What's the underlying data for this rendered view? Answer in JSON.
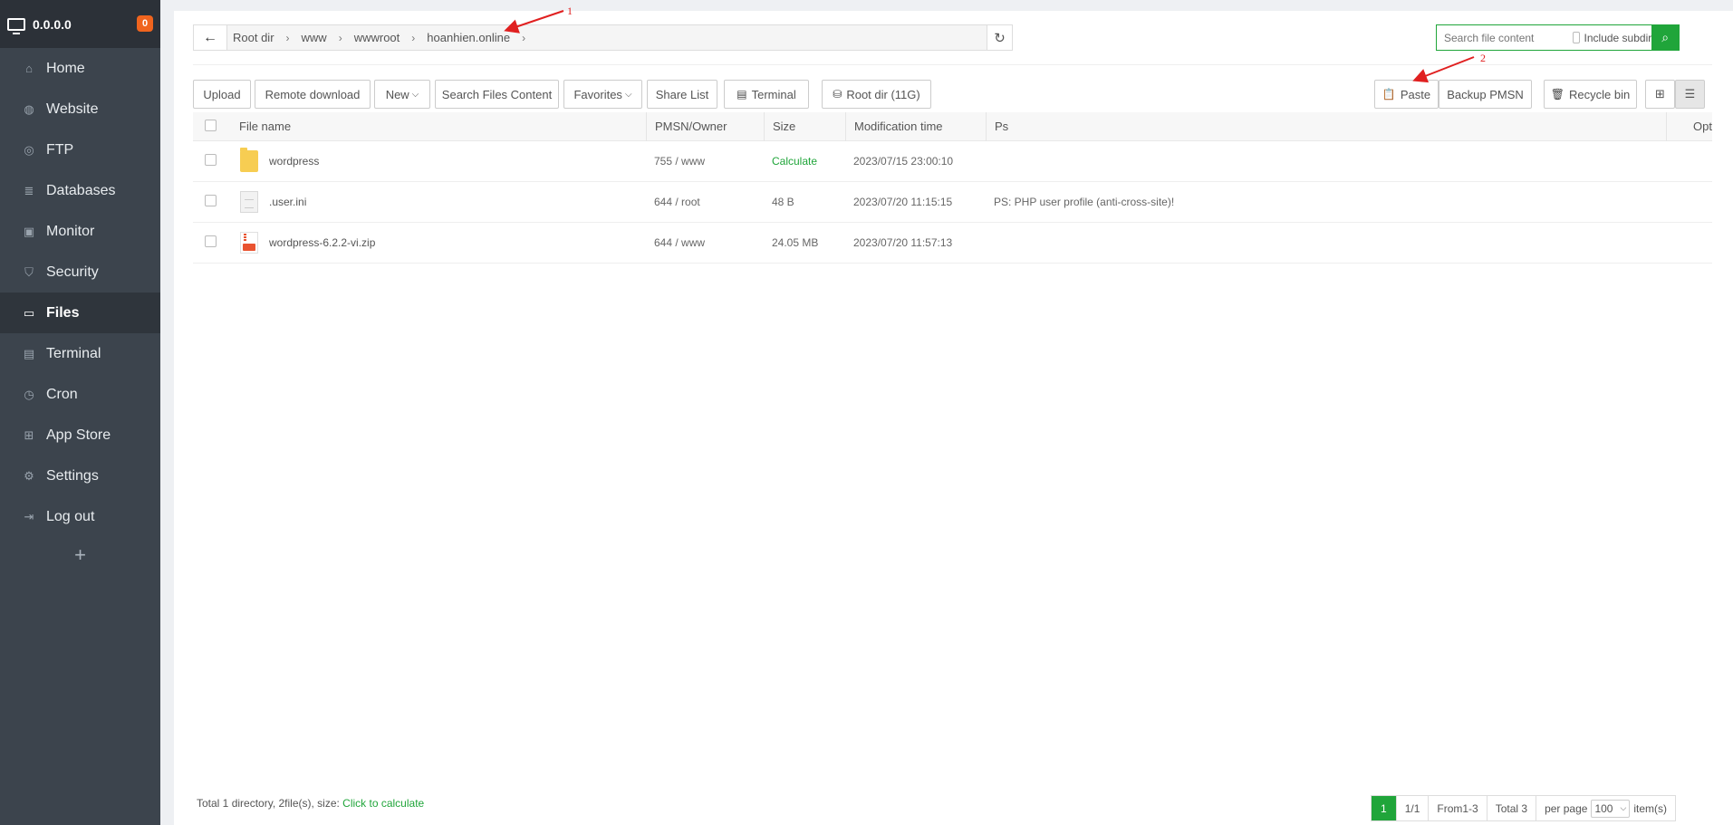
{
  "sidebar": {
    "title": "0.0.0.0",
    "badge": "0",
    "items": [
      {
        "label": "Home",
        "icon": "home-icon"
      },
      {
        "label": "Website",
        "icon": "globe-icon"
      },
      {
        "label": "FTP",
        "icon": "ftp-icon"
      },
      {
        "label": "Databases",
        "icon": "database-icon"
      },
      {
        "label": "Monitor",
        "icon": "monitor-icon"
      },
      {
        "label": "Security",
        "icon": "shield-icon"
      },
      {
        "label": "Files",
        "icon": "folder-icon",
        "active": true
      },
      {
        "label": "Terminal",
        "icon": "terminal-icon"
      },
      {
        "label": "Cron",
        "icon": "clock-icon"
      },
      {
        "label": "App Store",
        "icon": "grid-icon"
      },
      {
        "label": "Settings",
        "icon": "gear-icon"
      },
      {
        "label": "Log out",
        "icon": "logout-icon"
      }
    ],
    "add_label": "+"
  },
  "pathbar": {
    "crumbs": [
      "Root dir",
      "www",
      "wwwroot",
      "hoanhien.online"
    ]
  },
  "search": {
    "placeholder": "Search file content",
    "subdir_label": "Include subdir"
  },
  "toolbar": {
    "upload": "Upload",
    "remote_download": "Remote download",
    "new": "New",
    "search_files_content": "Search Files Content",
    "favorites": "Favorites",
    "share_list": "Share List",
    "terminal": "Terminal",
    "root_dir": "Root dir (11G)",
    "paste": "Paste",
    "backup": "Backup PMSN",
    "recycle_bin": "Recycle bin"
  },
  "table": {
    "headers": {
      "name": "File name",
      "perm": "PMSN/Owner",
      "size": "Size",
      "time": "Modification time",
      "ps": "Ps",
      "opt": "Opt"
    },
    "rows": [
      {
        "name": "wordpress",
        "type": "folder",
        "perm": "755 / www",
        "size": "Calculate",
        "time": "2023/07/15 23:00:10",
        "ps": ""
      },
      {
        "name": ".user.ini",
        "type": "doc",
        "perm": "644 / root",
        "size": "48 B",
        "time": "2023/07/20 11:15:15",
        "ps": "PS: PHP user profile (anti-cross-site)!"
      },
      {
        "name": "wordpress-6.2.2-vi.zip",
        "type": "zip",
        "perm": "644 / www",
        "size": "24.05 MB",
        "time": "2023/07/20 11:57:13",
        "ps": ""
      }
    ]
  },
  "footer": {
    "summary": "Total 1 directory, 2file(s), size:",
    "calc_link": "Click to calculate",
    "page_current": "1",
    "page_of": "1/1",
    "range": "From1-3",
    "total": "Total 3",
    "per_page_label": "per page",
    "per_page_value": "100",
    "items_label": "item(s)"
  },
  "annotations": {
    "arrow1": "1",
    "arrow2": "2"
  },
  "colors": {
    "accent": "#20a53a",
    "sidebar_bg": "#3c444d",
    "annotation": "#e02020",
    "badge": "#f0641e"
  }
}
